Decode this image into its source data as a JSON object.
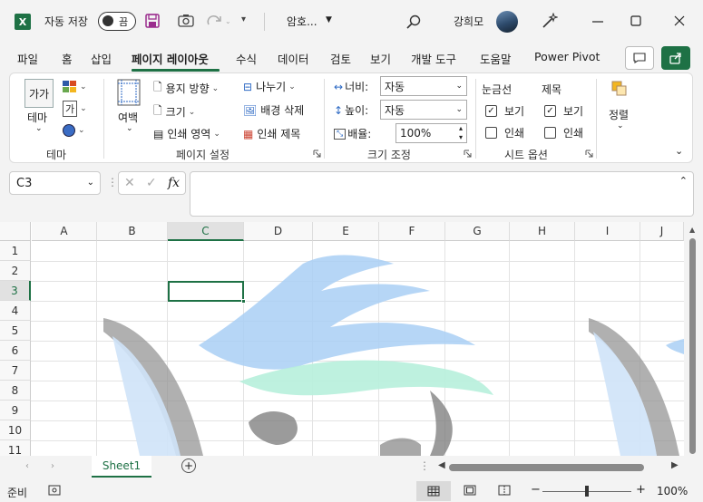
{
  "titlebar": {
    "app_icon": "X",
    "autosave_label": "자동 저장",
    "autosave_state": "끔",
    "filename": "암호...",
    "username": "강희모",
    "icons": [
      "save-icon",
      "camera-icon",
      "redo-icon",
      "search-icon",
      "designer-wand-icon",
      "minimize-icon",
      "maximize-icon",
      "close-icon"
    ]
  },
  "tabs": [
    {
      "label": "파일"
    },
    {
      "label": "홈"
    },
    {
      "label": "삽입"
    },
    {
      "label": "페이지 레이아웃",
      "active": true
    },
    {
      "label": "수식"
    },
    {
      "label": "데이터"
    },
    {
      "label": "검토"
    },
    {
      "label": "보기"
    },
    {
      "label": "개발 도구"
    },
    {
      "label": "도움말"
    },
    {
      "label": "Power Pivot"
    }
  ],
  "ribbon": {
    "theme": {
      "button": "테마",
      "icon_text": "가가",
      "group": "테마"
    },
    "page_setup": {
      "margins": "여백",
      "orientation": "용지 방향",
      "size": "크기",
      "print_area": "인쇄 영역",
      "breaks": "나누기",
      "delete_background": "배경 삭제",
      "print_titles": "인쇄 제목",
      "group": "페이지 설정"
    },
    "scale_to_fit": {
      "width_label": "너비:",
      "width_value": "자동",
      "height_label": "높이:",
      "height_value": "자동",
      "scale_label": "배율:",
      "scale_value": "100%",
      "group": "크기 조정"
    },
    "sheet_options": {
      "gridlines": "눈금선",
      "headings": "제목",
      "view": "보기",
      "print": "인쇄",
      "gridlines_view": true,
      "gridlines_print": false,
      "headings_view": true,
      "headings_print": false,
      "group": "시트 옵션"
    },
    "arrange": {
      "button": "정렬"
    }
  },
  "formula_bar": {
    "name_box": "C3",
    "fx": "fx",
    "formula": ""
  },
  "grid": {
    "columns": [
      "A",
      "B",
      "C",
      "D",
      "E",
      "F",
      "G",
      "H",
      "I",
      "J"
    ],
    "rows": [
      "1",
      "2",
      "3",
      "4",
      "5",
      "6",
      "7",
      "8",
      "9",
      "10",
      "11"
    ],
    "selected_column": "C",
    "selected_row": "3"
  },
  "sheets": [
    {
      "name": "Sheet1",
      "active": true
    }
  ],
  "statusbar": {
    "ready": "준비",
    "zoom": "100%",
    "minus": "−",
    "plus": "+"
  },
  "colors": {
    "accent": "#1e7145",
    "watermark_blue": "#a9cff5",
    "watermark_mint": "#b7f0dc"
  }
}
